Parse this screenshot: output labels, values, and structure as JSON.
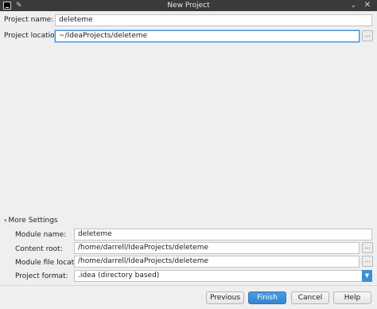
{
  "window": {
    "title": "New Project",
    "pin_glyph": "✎",
    "collapse_glyph": "⌄",
    "close_glyph": "✕",
    "icons": [
      "intellij-logo-icon",
      "pin-icon",
      "chevron-down-icon",
      "close-icon"
    ]
  },
  "form": {
    "project_name_label": "Project name:",
    "project_name_value": "deleteme",
    "project_location_label": "Project location:",
    "project_location_value": "~/IdeaProjects/deleteme"
  },
  "more_settings": {
    "toggle_glyph": "▾",
    "toggle_label": "More Settings",
    "module_name_label": "Module name:",
    "module_name_value": "deleteme",
    "content_root_label": "Content root:",
    "content_root_value": "/home/darrell/IdeaProjects/deleteme",
    "module_file_label": "Module file location:",
    "module_file_value": "/home/darrell/IdeaProjects/deleteme",
    "project_format_label": "Project format:",
    "project_format_value": ".idea (directory based)",
    "select_arrow_glyph": "▼"
  },
  "browse_glyph": "…",
  "buttons": {
    "previous": "Previous",
    "finish": "Finish",
    "cancel": "Cancel",
    "help": "Help"
  },
  "colors": {
    "accent": "#3d8fd9",
    "titlebar": "#3a3a3a"
  }
}
